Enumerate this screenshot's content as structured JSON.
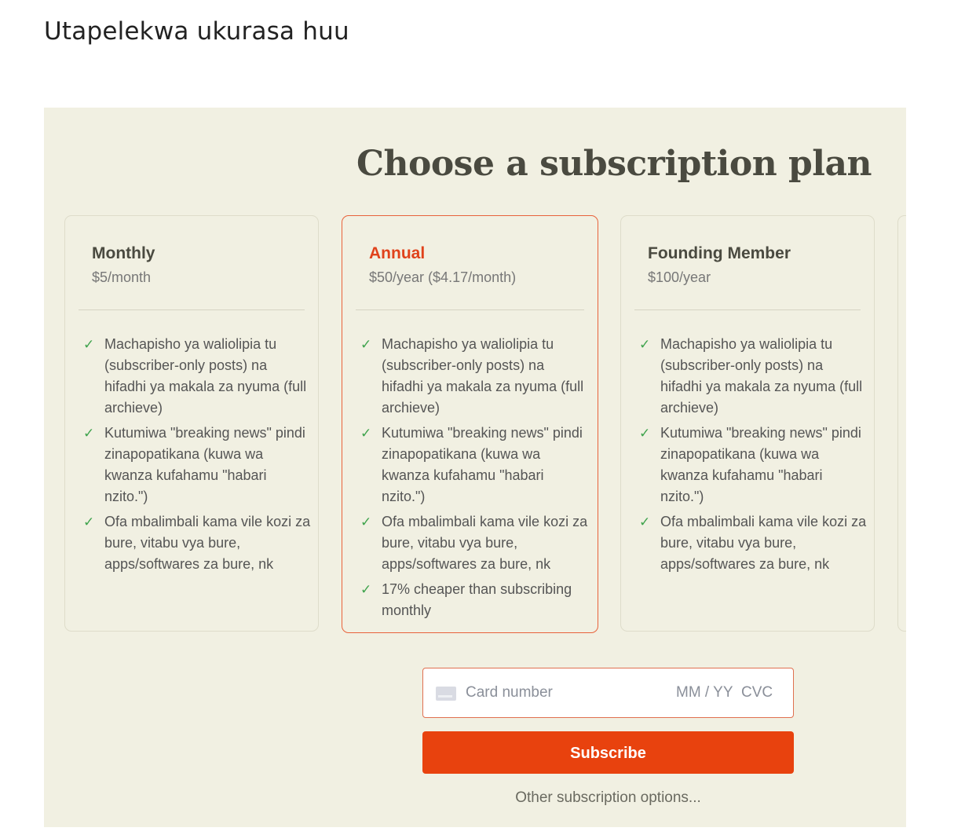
{
  "page": {
    "heading": "Utapelekwa ukurasa huu"
  },
  "panel": {
    "title": "Choose a subscription plan",
    "background_color": "#f1f0e2"
  },
  "plans": [
    {
      "name": "Monthly",
      "price": "$5/month",
      "selected": false,
      "features": [
        "Machapisho ya waliolipia tu (subscriber-only posts) na hifadhi ya makala za nyuma (full archieve)",
        "Kutumiwa \"breaking news\" pindi zinapopatikana (kuwa wa kwanza kufahamu \"habari nzito.\")",
        "Ofa mbalimbali kama vile kozi za bure, vitabu vya bure, apps/softwares za bure, nk"
      ]
    },
    {
      "name": "Annual",
      "price": "$50/year ($4.17/month)",
      "selected": true,
      "features": [
        "Machapisho ya waliolipia tu (subscriber-only posts) na hifadhi ya makala za nyuma (full archieve)",
        "Kutumiwa \"breaking news\" pindi zinapopatikana (kuwa wa kwanza kufahamu \"habari nzito.\")",
        "Ofa mbalimbali kama vile kozi za bure, vitabu vya bure, apps/softwares za bure, nk",
        "17% cheaper than subscribing monthly"
      ]
    },
    {
      "name": "Founding Member",
      "price": "$100/year",
      "selected": false,
      "features": [
        "Machapisho ya waliolipia tu (subscriber-only posts) na hifadhi ya makala za nyuma (full archieve)",
        "Kutumiwa \"breaking news\" pindi zinapopatikana (kuwa wa kwanza kufahamu \"habari nzito.\")",
        "Ofa mbalimbali kama vile kozi za bure, vitabu vya bure, apps/softwares za bure, nk"
      ]
    }
  ],
  "payment": {
    "card_placeholder": "Card number",
    "expiry_placeholder": "MM / YY",
    "cvc_placeholder": "CVC",
    "card_icon": "credit-card-icon",
    "subscribe_label": "Subscribe",
    "other_options_label": "Other subscription options..."
  },
  "colors": {
    "accent": "#e8420e",
    "selected_border": "#e8623b",
    "check": "#3fa34d"
  }
}
